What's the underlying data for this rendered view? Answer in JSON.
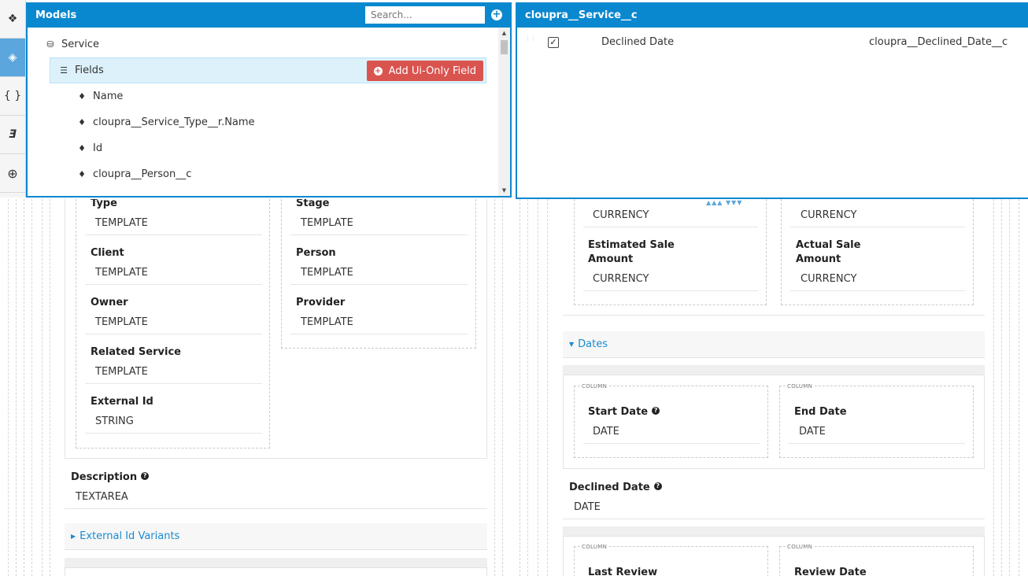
{
  "rail": {
    "items": [
      {
        "icon": "cubes-icon",
        "glyph": "❖"
      },
      {
        "icon": "cube-icon",
        "glyph": "◈"
      },
      {
        "icon": "braces-icon",
        "glyph": "{ }"
      },
      {
        "icon": "css3-icon",
        "glyph": "Ǝ"
      },
      {
        "icon": "globe-icon",
        "glyph": "⊕"
      }
    ]
  },
  "models": {
    "title": "Models",
    "search_placeholder": "Search...",
    "tree": {
      "root": "Service",
      "fields_label": "Fields",
      "add_button": "Add Ui-Only Field",
      "items": [
        "Name",
        "cloupra__Service_Type__r.Name",
        "Id",
        "cloupra__Person__c"
      ]
    }
  },
  "object": {
    "title": "cloupra__Service__c",
    "rows": [
      {
        "label": "Declined Date",
        "api": "cloupra__Declined_Date__c"
      }
    ]
  },
  "canvas": {
    "left_col1": [
      {
        "label": "Type",
        "value": "TEMPLATE"
      },
      {
        "label": "Client",
        "value": "TEMPLATE"
      },
      {
        "label": "Owner",
        "value": "TEMPLATE"
      },
      {
        "label": "Related Service",
        "value": "TEMPLATE"
      },
      {
        "label": "External Id",
        "value": "STRING"
      }
    ],
    "left_col2": [
      {
        "label": "Stage",
        "value": "TEMPLATE"
      },
      {
        "label": "Person",
        "value": "TEMPLATE"
      },
      {
        "label": "Provider",
        "value": "TEMPLATE"
      }
    ],
    "description": {
      "label": "Description",
      "value": "TEXTAREA"
    },
    "external_variants": "External Id Variants",
    "right_top": {
      "c1_value": "CURRENCY",
      "c2_value": "CURRENCY",
      "estimated": {
        "label1": "Estimated Sale",
        "label2": "Amount",
        "value": "CURRENCY"
      },
      "actual": {
        "label1": "Actual Sale",
        "label2": "Amount",
        "value": "CURRENCY"
      }
    },
    "dates_section": "Dates",
    "column_label": "COLUMN",
    "start_date": {
      "label": "Start Date",
      "value": "DATE"
    },
    "end_date": {
      "label": "End Date",
      "value": "DATE"
    },
    "declined_date": {
      "label": "Declined Date",
      "value": "DATE"
    },
    "last_review": "Last Review",
    "review_date": "Review Date",
    "help_glyph": "?"
  }
}
